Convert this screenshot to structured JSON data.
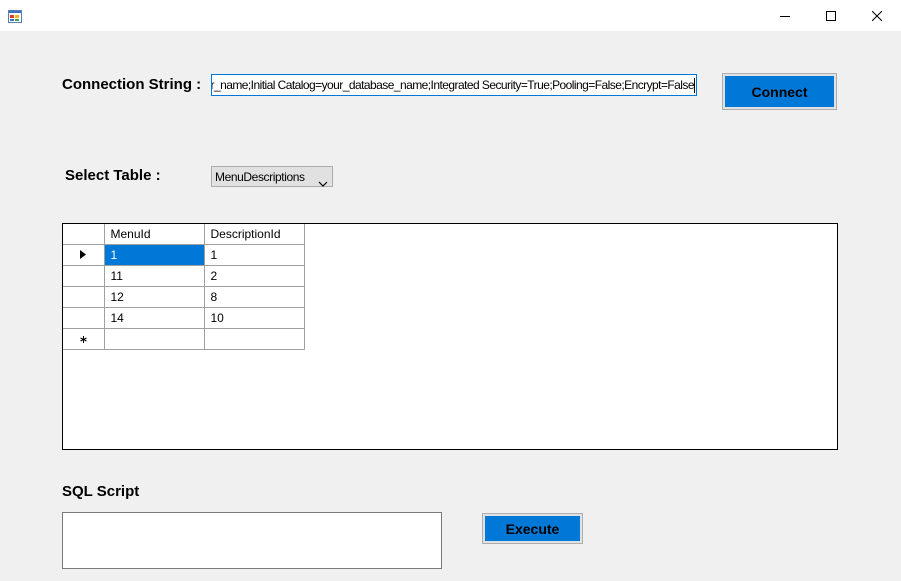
{
  "window": {
    "icon": "form-app-icon",
    "controls": [
      "minimize-icon",
      "maximize-icon",
      "close-icon"
    ]
  },
  "connection": {
    "label": "Connection String :",
    "value": "ver_name;Initial Catalog=your_database_name;Integrated Security=True;Pooling=False;Encrypt=False",
    "button_label": "Connect"
  },
  "table_select": {
    "label": "Select Table :",
    "selected": "MenuDescriptions"
  },
  "grid": {
    "columns": [
      "MenuId",
      "DescriptionId"
    ],
    "rows": [
      [
        "1",
        "1"
      ],
      [
        "11",
        "2"
      ],
      [
        "12",
        "8"
      ],
      [
        "14",
        "10"
      ]
    ],
    "current_row_marker": "current-row-arrow-icon",
    "new_row_marker": "new-row-asterisk-icon"
  },
  "sql": {
    "label": "SQL Script",
    "value": "",
    "button_label": "Execute"
  },
  "colors": {
    "accent": "#0078d7",
    "background": "#f0f0f0",
    "button_border": "#adadad"
  }
}
